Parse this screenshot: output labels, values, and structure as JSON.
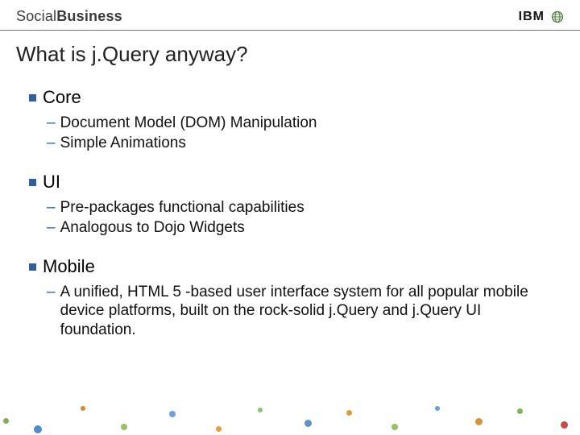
{
  "header": {
    "brand_light": "Social",
    "brand_bold": "Business",
    "ibm": "IBM"
  },
  "title": "What is j.Query anyway?",
  "sections": [
    {
      "title": "Core",
      "items": [
        "Document Model (DOM) Manipulation",
        "Simple Animations"
      ]
    },
    {
      "title": "UI",
      "items": [
        "Pre-packages functional capabilities",
        "Analogous to Dojo Widgets"
      ]
    },
    {
      "title": "Mobile",
      "items": [
        "A unified, HTML 5 -based user interface system for all popular mobile device platforms, built on the rock-solid j.Query and j.Query UI foundation."
      ]
    }
  ],
  "colors": {
    "accent_blue": "#2f5f9e",
    "header_rule": "#707070"
  }
}
